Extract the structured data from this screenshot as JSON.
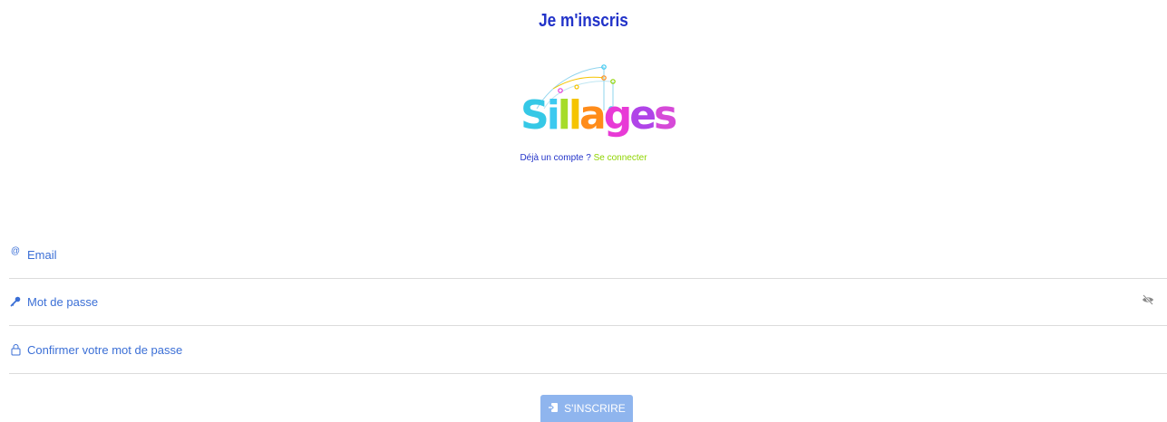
{
  "header": {
    "title": "Je m'inscris"
  },
  "logo": {
    "letters": [
      {
        "char": "S",
        "color": "#35c8e6"
      },
      {
        "char": "i",
        "color": "#3cc9f0"
      },
      {
        "char": "l",
        "color": "#a6dc2a"
      },
      {
        "char": "l",
        "color": "#f5c400"
      },
      {
        "char": "a",
        "color": "#ff8c1a"
      },
      {
        "char": "g",
        "color": "#e83ad6"
      },
      {
        "char": "e",
        "color": "#b044e8"
      },
      {
        "char": "s",
        "color": "#d64ad8"
      }
    ]
  },
  "login_prompt": {
    "question": "Déjà un compte ? ",
    "link_label": "Se connecter"
  },
  "form": {
    "email": {
      "placeholder": "Email",
      "icon": "at-icon"
    },
    "password": {
      "placeholder": "Mot de passe",
      "icon": "key-icon",
      "toggle_icon": "eye-slash-icon"
    },
    "confirm_password": {
      "placeholder": "Confirmer votre mot de passe",
      "icon": "lock-icon"
    },
    "submit_label": "S'INSCRIRE"
  },
  "colors": {
    "title": "#2233c9",
    "field_text": "#3b6fd6",
    "link": "#8fd400",
    "button_bg": "#8fb5ee"
  }
}
